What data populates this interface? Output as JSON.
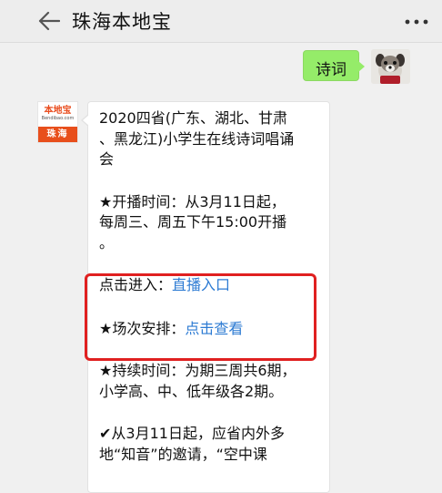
{
  "header": {
    "title": "珠海本地宝",
    "back_icon": "arrow-left-icon",
    "more_icon": "more-dots-icon"
  },
  "user_message": {
    "text": "诗词",
    "bubble_color": "#95ec69"
  },
  "bot_avatar": {
    "logo_main": "本地宝",
    "logo_sub": "Bendibao.com",
    "logo_city": "珠海",
    "accent_color": "#e84f1c"
  },
  "bot_message": {
    "title": "2020四省(广东、湖北、甘肃\n、黑龙江)小学生在线诗词唱诵\n会",
    "broadcast_time": "★开播时间：从3月11日起，\n每周三、周五下午15:00开播\n。",
    "enter_prefix": "点击进入：",
    "enter_link": "直播入口",
    "schedule_prefix": "★场次安排：",
    "schedule_link": "点击查看",
    "duration": "★持续时间：为期三周共6期，\n小学高、中、低年级各2期。",
    "extra": "✔从3月11日起，应省内外多\n地“知音”的邀请，“空中课",
    "link_color": "#2d7bd3",
    "highlight_color": "#e02020"
  }
}
